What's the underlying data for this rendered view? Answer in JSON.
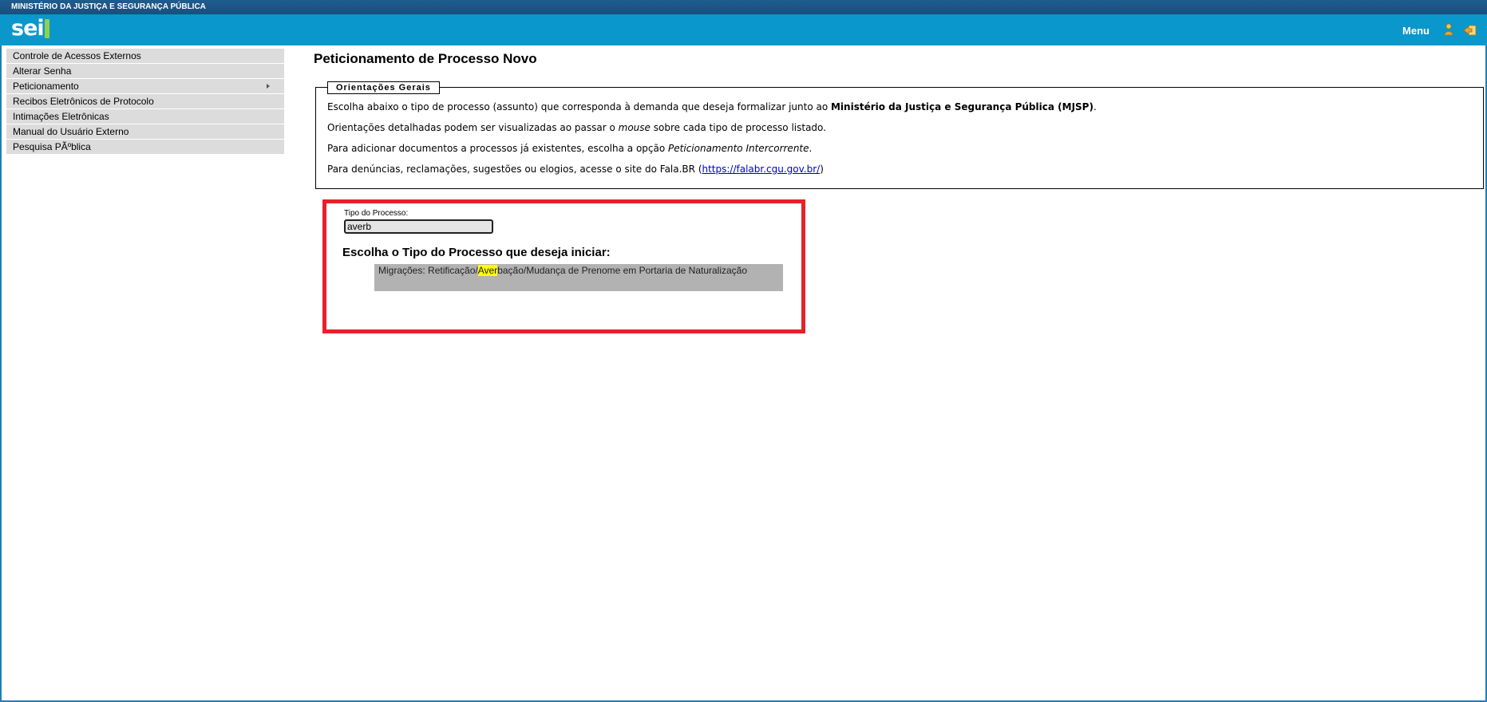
{
  "header": {
    "org_name": "MINISTÉRIO DA JUSTIÇA E SEGURANÇA PÚBLICA",
    "logo_text": "sei",
    "menu_label": "Menu",
    "user_icon": "user-icon",
    "exit_icon": "exit-icon",
    "header_color": "#0a97cc"
  },
  "sidebar": {
    "items": [
      {
        "label": "Controle de Acessos Externos"
      },
      {
        "label": "Alterar Senha"
      },
      {
        "label": "Peticionamento",
        "has_submenu": true
      },
      {
        "label": "Recibos Eletrônicos de Protocolo"
      },
      {
        "label": "Intimações Eletrônicas"
      },
      {
        "label": "Manual do Usuário Externo"
      },
      {
        "label": "Pesquisa PÃºblica"
      }
    ]
  },
  "main": {
    "title": "Peticionamento de Processo Novo",
    "orientacoes": {
      "legend": "Orientações Gerais",
      "line1_prefix": "Escolha abaixo o tipo de processo (assunto) que corresponda à demanda que deseja formalizar junto ao ",
      "line1_bold": "Ministério da Justiça e Segurança Pública (MJSP)",
      "line1_suffix": ".",
      "line2_prefix": "Orientações detalhadas podem ser visualizadas ao passar o ",
      "line2_italic": "mouse",
      "line2_suffix": " sobre cada tipo de processo listado.",
      "line3_prefix": "Para adicionar documentos a processos já existentes, escolha a opção ",
      "line3_italic": "Peticionamento Intercorrente",
      "line3_suffix": ".",
      "line4_prefix": "Para denúncias, reclamações, sugestões ou elogios, acesse o site do Fala.BR (",
      "line4_link": "https://falabr.cgu.gov.br/",
      "line4_suffix": ")"
    },
    "tipo_processo": {
      "label": "Tipo do Processo:",
      "value": "averb",
      "heading": "Escolha o Tipo do Processo que deseja iniciar:",
      "result_prefix": "Migrações: Retificação/",
      "result_highlight": "Aver",
      "result_suffix": "bação/Mudança de Prenome em Portaria de Naturalização"
    },
    "highlight_color": "#e8202a"
  }
}
